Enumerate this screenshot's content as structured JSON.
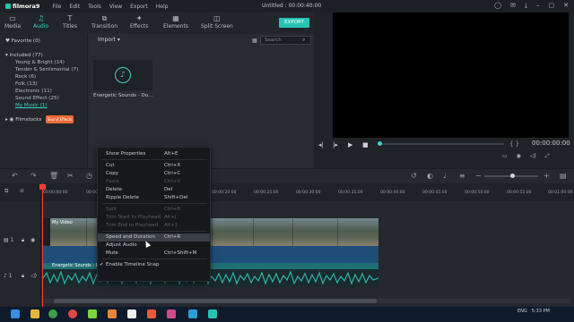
{
  "app": {
    "logo": "filmora9",
    "menu": [
      "File",
      "Edit",
      "Tools",
      "View",
      "Export",
      "Help"
    ],
    "title": "Untitled : 00:00:40:00"
  },
  "toolbar": {
    "tabs": [
      {
        "label": "Media",
        "icon": "folder-icon"
      },
      {
        "label": "Audio",
        "icon": "music-note-icon"
      },
      {
        "label": "Titles",
        "icon": "title-icon"
      },
      {
        "label": "Transition",
        "icon": "transition-icon"
      },
      {
        "label": "Effects",
        "icon": "effects-icon"
      },
      {
        "label": "Elements",
        "icon": "elements-icon"
      },
      {
        "label": "Split Screen",
        "icon": "split-screen-icon"
      }
    ],
    "export_label": "EXPORT"
  },
  "sidebar": {
    "favorite": "Favorite (0)",
    "included": "Included (77)",
    "items": [
      "Young & Bright (14)",
      "Tender & Sentimental (7)",
      "Rock (6)",
      "Folk (13)",
      "Electronic (11)",
      "Sound Effect (25)"
    ],
    "my_music": "My Music (1)",
    "filmstocks": "Filmstocks",
    "filmstocks_badge": "Sound Effects"
  },
  "media": {
    "import_label": "Import",
    "search_placeholder": "Search",
    "item_label": "Energetic Sounds - Do..."
  },
  "preview": {
    "timecode": "00:00:00:00",
    "bracket_label": "{ }"
  },
  "timeline": {
    "ticks": [
      "00:00:00:00",
      "00:00:05:00",
      "00:00:10:00",
      "00:00:15:00",
      "00:00:20:00",
      "00:00:25:00",
      "00:00:30:00",
      "00:00:35:00",
      "00:00:40:00",
      "00:00:45:00",
      "00:00:50:00",
      "00:00:55:00",
      "00:01:00:00"
    ],
    "video_clip_label": "My Video",
    "audio_clip_label": "Energetic Sounds - Do",
    "track_video": "1",
    "track_audio": "1"
  },
  "context_menu": [
    {
      "label": "Show Properties",
      "shortcut": "Alt+E",
      "enabled": true
    },
    {
      "sep": true
    },
    {
      "label": "Cut",
      "shortcut": "Ctrl+X",
      "enabled": true
    },
    {
      "label": "Copy",
      "shortcut": "Ctrl+C",
      "enabled": true
    },
    {
      "label": "Paste",
      "shortcut": "Ctrl+V",
      "enabled": false
    },
    {
      "label": "Delete",
      "shortcut": "Del",
      "enabled": true
    },
    {
      "label": "Ripple Delete",
      "shortcut": "Shift+Del",
      "enabled": true
    },
    {
      "sep": true
    },
    {
      "label": "Split",
      "shortcut": "Ctrl+B",
      "enabled": false
    },
    {
      "label": "Trim Start to Playhead",
      "shortcut": "Alt+[",
      "enabled": false
    },
    {
      "label": "Trim End to Playhead",
      "shortcut": "Alt+]",
      "enabled": false
    },
    {
      "sep": true
    },
    {
      "label": "Speed and Duration",
      "shortcut": "Ctrl+R",
      "enabled": true,
      "highlighted": true
    },
    {
      "label": "Adjust Audio",
      "shortcut": "",
      "enabled": true
    },
    {
      "label": "Mute",
      "shortcut": "Ctrl+Shift+M",
      "enabled": true
    },
    {
      "sep": true
    },
    {
      "label": "Enable Timeline Snap",
      "shortcut": "",
      "enabled": true,
      "checked": true
    }
  ],
  "taskbar": {
    "tray_lang": "ENG",
    "tray_time": "5:33 PM",
    "tray_date": "2/14/2020"
  },
  "colors": {
    "accent": "#27c4b4",
    "playhead": "#ff3a3a",
    "badge": "#ef6b3a",
    "audio_clip": "#1f6f74",
    "linked_audio": "#1e4e78"
  }
}
